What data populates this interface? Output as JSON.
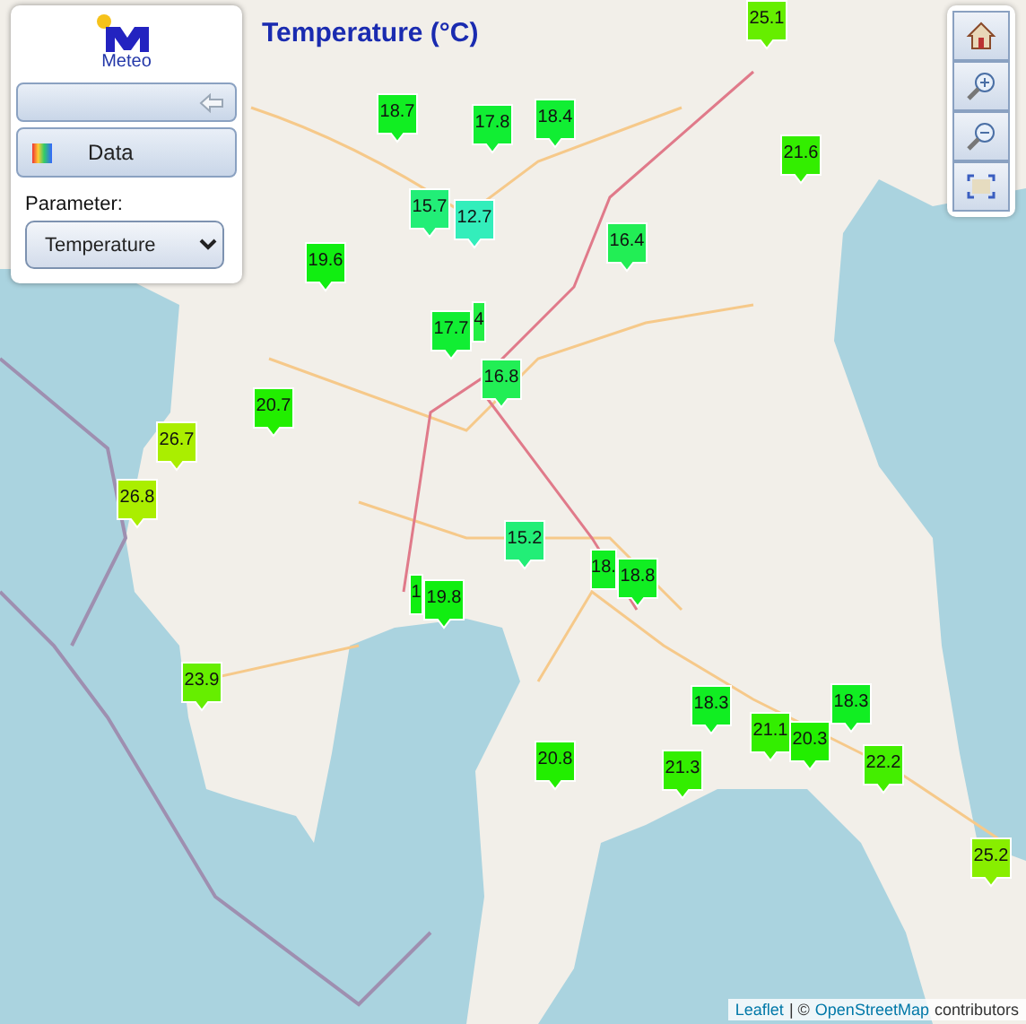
{
  "panel": {
    "logo_text": "Meteo",
    "data_button": "Data",
    "parameter_label": "Parameter:",
    "parameter_select": "Temperature"
  },
  "map": {
    "title": "Temperature (°C)",
    "markers": [
      {
        "value": "25.1",
        "color": "#66ee00"
      },
      {
        "value": "18.7",
        "color": "#11ee22"
      },
      {
        "value": "17.8",
        "color": "#11ee33"
      },
      {
        "value": "18.4",
        "color": "#11ee33"
      },
      {
        "value": "21.6",
        "color": "#33ee00"
      },
      {
        "value": "15.7",
        "color": "#22ee77"
      },
      {
        "value": "12.7",
        "color": "#33eebb"
      },
      {
        "value": "16.4",
        "color": "#22ee55"
      },
      {
        "value": "19.6",
        "color": "#11ee11"
      },
      {
        "value": "4",
        "color": "#22ee44"
      },
      {
        "value": "17.7",
        "color": "#11ee33"
      },
      {
        "value": "16.8",
        "color": "#22ee55"
      },
      {
        "value": "20.7",
        "color": "#22ee00"
      },
      {
        "value": "26.7",
        "color": "#aaee00"
      },
      {
        "value": "26.8",
        "color": "#aaee00"
      },
      {
        "value": "15.2",
        "color": "#22ee77"
      },
      {
        "value": "18.",
        "color": "#11ee22"
      },
      {
        "value": "18.8",
        "color": "#11ee22"
      },
      {
        "value": "1",
        "color": "#11ee11"
      },
      {
        "value": "19.8",
        "color": "#11ee11"
      },
      {
        "value": "23.9",
        "color": "#66ee00"
      },
      {
        "value": "18.3",
        "color": "#11ee22"
      },
      {
        "value": "18.3",
        "color": "#11ee22"
      },
      {
        "value": "20.8",
        "color": "#22ee00"
      },
      {
        "value": "21.3",
        "color": "#33ee00"
      },
      {
        "value": "21.1",
        "color": "#33ee00"
      },
      {
        "value": "20.3",
        "color": "#22ee00"
      },
      {
        "value": "22.2",
        "color": "#44ee00"
      },
      {
        "value": "25.2",
        "color": "#88ee00"
      }
    ],
    "attribution": {
      "leaflet_link": "Leaflet",
      "separator": "| ©",
      "osm_link": "OpenStreetMap",
      "suffix": "contributors"
    }
  }
}
